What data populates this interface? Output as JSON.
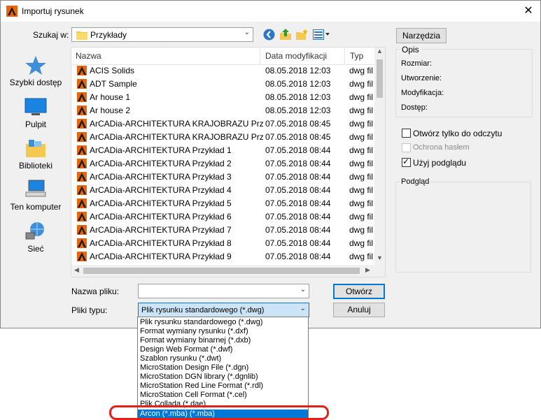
{
  "window": {
    "title": "Importuj rysunek",
    "close_glyph": "✕"
  },
  "lookin": {
    "label": "Szukaj w:",
    "value": "Przykłady"
  },
  "toolbar": {
    "tools_label": "Narzędzia"
  },
  "places": [
    {
      "label": "Szybki dostęp",
      "icon": "quick-access-star-icon"
    },
    {
      "label": "Pulpit",
      "icon": "desktop-icon"
    },
    {
      "label": "Biblioteki",
      "icon": "libraries-icon"
    },
    {
      "label": "Ten komputer",
      "icon": "computer-icon"
    },
    {
      "label": "Sieć",
      "icon": "network-icon"
    }
  ],
  "filelist": {
    "columns": [
      "Nazwa",
      "Data modyfikacji",
      "Typ"
    ],
    "rows": [
      {
        "name": "ACIS Solids",
        "date": "08.05.2018 12:03",
        "type": "dwg fil"
      },
      {
        "name": "ADT Sample",
        "date": "08.05.2018 12:03",
        "type": "dwg fil"
      },
      {
        "name": "Ar house 1",
        "date": "08.05.2018 12:03",
        "type": "dwg fil"
      },
      {
        "name": "Ar house 2",
        "date": "08.05.2018 12:03",
        "type": "dwg fil"
      },
      {
        "name": "ArCADia-ARCHITEKTURA KRAJOBRAZU Prz...",
        "date": "07.05.2018 08:45",
        "type": "dwg fil"
      },
      {
        "name": "ArCADia-ARCHITEKTURA KRAJOBRAZU Prz...",
        "date": "07.05.2018 08:45",
        "type": "dwg fil"
      },
      {
        "name": "ArCADia-ARCHITEKTURA Przykład 1",
        "date": "07.05.2018 08:44",
        "type": "dwg fil"
      },
      {
        "name": "ArCADia-ARCHITEKTURA Przykład 2",
        "date": "07.05.2018 08:44",
        "type": "dwg fil"
      },
      {
        "name": "ArCADia-ARCHITEKTURA Przykład 3",
        "date": "07.05.2018 08:44",
        "type": "dwg fil"
      },
      {
        "name": "ArCADia-ARCHITEKTURA Przykład 4",
        "date": "07.05.2018 08:44",
        "type": "dwg fil"
      },
      {
        "name": "ArCADia-ARCHITEKTURA Przykład 5",
        "date": "07.05.2018 08:44",
        "type": "dwg fil"
      },
      {
        "name": "ArCADia-ARCHITEKTURA Przykład 6",
        "date": "07.05.2018 08:44",
        "type": "dwg fil"
      },
      {
        "name": "ArCADia-ARCHITEKTURA Przykład 7",
        "date": "07.05.2018 08:44",
        "type": "dwg fil"
      },
      {
        "name": "ArCADia-ARCHITEKTURA Przykład 8",
        "date": "07.05.2018 08:44",
        "type": "dwg fil"
      },
      {
        "name": "ArCADia-ARCHITEKTURA Przykład 9",
        "date": "07.05.2018 08:44",
        "type": "dwg fil"
      }
    ]
  },
  "info": {
    "group_label": "Opis",
    "size_label": "Rozmiar:",
    "created_label": "Utworzenie:",
    "modified_label": "Modyfikacja:",
    "access_label": "Dostęp:"
  },
  "options": {
    "readonly_label": "Otwórz tylko do odczytu",
    "password_label": "Ochrona hasłem",
    "preview_label": "Użyj podglądu",
    "readonly_checked": false,
    "password_checked": false,
    "preview_checked": true
  },
  "preview": {
    "group_label": "Podgląd"
  },
  "filename": {
    "label": "Nazwa pliku:",
    "value": ""
  },
  "filetype": {
    "label": "Pliki typu:",
    "value": "Plik rysunku standardowego (*.dwg)",
    "options": [
      "Plik rysunku standardowego (*.dwg)",
      "Format wymiany rysunku (*.dxf)",
      "Format wymiany binarnej (*.dxb)",
      "Design Web Format (*.dwf)",
      "Szablon rysunku (*.dwt)",
      "MicroStation Design File (*.dgn)",
      "MicroStation DGN library (*.dgnlib)",
      "MicroStation Red Line Format (*.rdl)",
      "MicroStation Cell Format (*.cel)",
      "Plik Collada (*.dae)",
      "Arcon (*.mba) (*.mba)"
    ],
    "highlighted_option": "Arcon (*.mba) (*.mba)"
  },
  "buttons": {
    "open_label": "Otwórz",
    "cancel_label": "Anuluj"
  },
  "colors": {
    "selection_blue": "#0078d7",
    "highlight_ring": "#e32119",
    "focus_blue": "#0078d7"
  }
}
